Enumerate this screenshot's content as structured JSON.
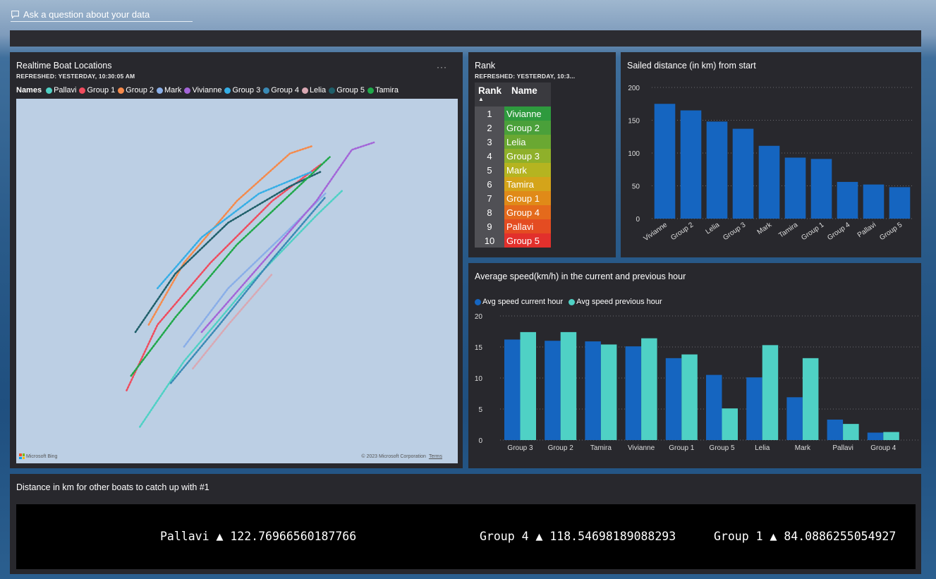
{
  "qa": {
    "placeholder": "Ask a question about your data"
  },
  "colors": {
    "Pallavi": "#4fd1c5",
    "Group 1": "#ef4c5e",
    "Group 2": "#f58a4b",
    "Mark": "#89aee8",
    "Vivianne": "#a365d8",
    "Group 3": "#35aee6",
    "Group 4": "#3a8ab5",
    "Lelia": "#d9a8b3",
    "Group 5": "#1f5f6a",
    "Tamira": "#20a84a"
  },
  "map_tile": {
    "title": "Realtime Boat Locations",
    "refreshed": "REFRESHED: YESTERDAY, 10:30:05 AM",
    "more_icon": "ellipsis-icon",
    "legend_title": "Names",
    "legend": [
      "Pallavi",
      "Group 1",
      "Group 2",
      "Mark",
      "Vivianne",
      "Group 3",
      "Group 4",
      "Lelia",
      "Group 5",
      "Tamira"
    ],
    "bing_label": "Microsoft Bing",
    "copyright": "© 2023 Microsoft Corporation",
    "terms": "Terms"
  },
  "rank_tile": {
    "title": "Rank",
    "refreshed": "REFRESHED: YESTERDAY, 10:3...",
    "col_rank": "Rank",
    "col_name": "Name",
    "rows": [
      {
        "rank": "1",
        "name": "Vivianne",
        "color": "#2e9a3e"
      },
      {
        "rank": "2",
        "name": "Group 2",
        "color": "#4aa03a"
      },
      {
        "rank": "3",
        "name": "Lelia",
        "color": "#6aa832"
      },
      {
        "rank": "4",
        "name": "Group 3",
        "color": "#8fb02a"
      },
      {
        "rank": "5",
        "name": "Mark",
        "color": "#b5b420"
      },
      {
        "rank": "6",
        "name": "Tamira",
        "color": "#d4a41a"
      },
      {
        "rank": "7",
        "name": "Group 1",
        "color": "#e08a18"
      },
      {
        "rank": "8",
        "name": "Group 4",
        "color": "#e46a1c"
      },
      {
        "rank": "9",
        "name": "Pallavi",
        "color": "#e44c22"
      },
      {
        "rank": "10",
        "name": "Group 5",
        "color": "#e2302c"
      }
    ]
  },
  "chart_data": [
    {
      "type": "bar",
      "title": "Sailed distance (in km) from start",
      "categories": [
        "Vivianne",
        "Group 2",
        "Lelia",
        "Group 3",
        "Mark",
        "Tamira",
        "Group 1",
        "Group 4",
        "Pallavi",
        "Group 5"
      ],
      "values": [
        175,
        165,
        148,
        137,
        111,
        93,
        91,
        56,
        52,
        48
      ],
      "ylim": [
        0,
        200
      ],
      "yticks": [
        0,
        50,
        100,
        150,
        200
      ],
      "color": "#1565c0",
      "grid": true
    },
    {
      "type": "bar",
      "title": "Average speed(km/h) in the current and previous hour",
      "categories": [
        "Group 3",
        "Group 2",
        "Tamira",
        "Vivianne",
        "Group 1",
        "Group 5",
        "Lelia",
        "Mark",
        "Pallavi",
        "Group 4"
      ],
      "series": [
        {
          "name": "Avg speed current hour",
          "color": "#1565c0",
          "values": [
            16.2,
            16.0,
            15.9,
            15.1,
            13.2,
            10.5,
            10.1,
            6.9,
            3.3,
            1.2
          ]
        },
        {
          "name": "Avg speed previous hour",
          "color": "#4fd1c5",
          "values": [
            17.4,
            17.4,
            15.4,
            16.4,
            13.8,
            5.1,
            15.3,
            13.2,
            2.6,
            1.3
          ]
        }
      ],
      "ylim": [
        0,
        20
      ],
      "yticks": [
        0,
        5,
        10,
        15,
        20
      ],
      "legend": "top-left",
      "grid": true
    }
  ],
  "kpi_tile": {
    "title": "Distance in km for other boats to catch up with #1",
    "items": [
      {
        "name": "Pallavi",
        "arrow": "▲",
        "value": "122.76966560187766"
      },
      {
        "name": "Group 4",
        "arrow": "▲",
        "value": "118.54698189088293"
      },
      {
        "name": "Group 1",
        "arrow": "▲",
        "value": "84.0886255054927"
      }
    ]
  },
  "map_tracks": [
    {
      "name": "Pallavi",
      "points": [
        [
          0.28,
          0.1
        ],
        [
          0.38,
          0.28
        ],
        [
          0.52,
          0.48
        ],
        [
          0.68,
          0.68
        ],
        [
          0.74,
          0.75
        ]
      ]
    },
    {
      "name": "Group 1",
      "points": [
        [
          0.25,
          0.2
        ],
        [
          0.32,
          0.38
        ],
        [
          0.44,
          0.55
        ],
        [
          0.58,
          0.72
        ],
        [
          0.69,
          0.82
        ]
      ]
    },
    {
      "name": "Group 2",
      "points": [
        [
          0.3,
          0.38
        ],
        [
          0.38,
          0.55
        ],
        [
          0.5,
          0.72
        ],
        [
          0.62,
          0.85
        ],
        [
          0.67,
          0.87
        ]
      ]
    },
    {
      "name": "Mark",
      "points": [
        [
          0.38,
          0.32
        ],
        [
          0.48,
          0.48
        ],
        [
          0.6,
          0.62
        ],
        [
          0.7,
          0.74
        ]
      ]
    },
    {
      "name": "Vivianne",
      "points": [
        [
          0.42,
          0.36
        ],
        [
          0.55,
          0.54
        ],
        [
          0.68,
          0.72
        ],
        [
          0.76,
          0.86
        ],
        [
          0.81,
          0.88
        ]
      ]
    },
    {
      "name": "Group 3",
      "points": [
        [
          0.32,
          0.48
        ],
        [
          0.42,
          0.62
        ],
        [
          0.55,
          0.74
        ],
        [
          0.67,
          0.8
        ]
      ]
    },
    {
      "name": "Group 4",
      "points": [
        [
          0.35,
          0.22
        ],
        [
          0.46,
          0.38
        ],
        [
          0.58,
          0.56
        ],
        [
          0.7,
          0.73
        ]
      ]
    },
    {
      "name": "Lelia",
      "points": [
        [
          0.4,
          0.26
        ],
        [
          0.48,
          0.38
        ],
        [
          0.58,
          0.52
        ]
      ]
    },
    {
      "name": "Group 5",
      "points": [
        [
          0.27,
          0.36
        ],
        [
          0.36,
          0.52
        ],
        [
          0.48,
          0.66
        ],
        [
          0.62,
          0.76
        ],
        [
          0.69,
          0.8
        ]
      ]
    },
    {
      "name": "Tamira",
      "points": [
        [
          0.26,
          0.24
        ],
        [
          0.36,
          0.4
        ],
        [
          0.5,
          0.6
        ],
        [
          0.64,
          0.76
        ],
        [
          0.71,
          0.84
        ]
      ]
    }
  ]
}
